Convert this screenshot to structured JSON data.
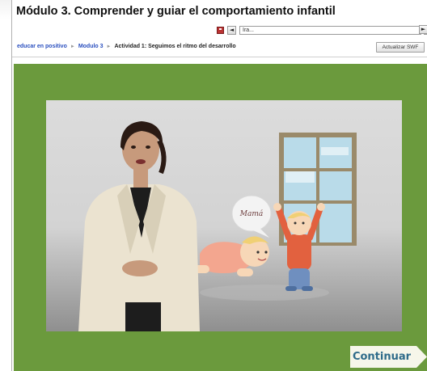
{
  "page": {
    "title": "Módulo 3. Comprender y guiar el comportamiento infantil"
  },
  "navigation": {
    "prev_label": "◄",
    "jump_value": "Ira...",
    "jump_arrow": "▼",
    "next_label": "►",
    "save_icon": "save-icon"
  },
  "breadcrumb": {
    "items": [
      "educar en positivo",
      "Modulo 3"
    ],
    "separator": "►",
    "current": "Actividad 1: Seguimos el ritmo del desarrollo"
  },
  "toolbar": {
    "refresh_label": "Actualizar SWF"
  },
  "activity": {
    "speech_bubble_text": "Mamá",
    "continue_label": "Continuar"
  },
  "colors": {
    "stage_green": "#6b9a3d",
    "link_blue": "#2a4fbf",
    "continue_text": "#2e6b8a"
  }
}
